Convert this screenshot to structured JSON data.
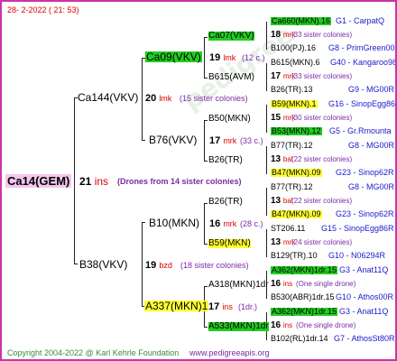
{
  "header": {
    "date": "28-  2-2022 ( 21: 53)"
  },
  "footer": {
    "copyright": "Copyright 2004-2022 @ Karl Kehrle Foundation",
    "url": "www.pedigreeapis.org"
  },
  "watermark": "pedigree",
  "root": {
    "id": "Ca14(GEM)",
    "count": "21",
    "unit": "ins",
    "note": "(Drones from 14 sister colonies)"
  },
  "gen1": {
    "top": {
      "id": "Ca144(VKV)",
      "count": "20",
      "unit": "lmk",
      "note": "(15 sister colonies)"
    },
    "bottom": {
      "id": "B38(VKV)",
      "count": "19",
      "unit": "bzd",
      "note": "(18 sister colonies)"
    }
  },
  "gen2": {
    "a": {
      "id": "Ca09(VKV)",
      "count": "19",
      "unit": "lmk",
      "note": "(12 c.)"
    },
    "b": {
      "id": "B76(VKV)",
      "count": "17",
      "unit": "mrk",
      "note": "(33 c.)"
    },
    "c": {
      "id": "B10(MKN)",
      "count": "16",
      "unit": "mrk",
      "note": "(28 c.)"
    },
    "d": {
      "id": "A337(MKN)1",
      "count": "17",
      "unit": "ins",
      "note": "(1dr.)"
    }
  },
  "gen3": {
    "a1": {
      "id": "Ca07(VKV)"
    },
    "a2": {
      "id": "B615(AVM)"
    },
    "b1": {
      "id": "B50(MKN)"
    },
    "b2": {
      "id": "B26(TR)"
    },
    "c1": {
      "id": "B26(TR)"
    },
    "c2": {
      "id": "B59(MKN)"
    },
    "d1": {
      "id": "A318(MKN)1dr"
    },
    "d2": {
      "id": "A533(MKN)1dr"
    }
  },
  "gen4": [
    {
      "id": "Ca660(MKN).16",
      "code": "G1 - CarpatQ"
    },
    {
      "count": "18",
      "unit": "mrk",
      "note": "(33 sister colonies)"
    },
    {
      "id": "B100(PJ).16",
      "code": "G8 - PrimGreen00"
    },
    {
      "id": "B615(MKN).6",
      "code": "G40 - Kangaroo98R"
    },
    {
      "count": "17",
      "unit": "mrk",
      "note": "(33 sister colonies)"
    },
    {
      "id": "B26(TR).13",
      "code": "G9 - MG00R"
    },
    {
      "id": "B59(MKN).1",
      "code": "G16 - SinopEgg86R"
    },
    {
      "count": "15",
      "unit": "mrk",
      "note": "(30 sister colonies)"
    },
    {
      "id": "B53(MKN).12",
      "code": "G5 - Gr.Rmounta"
    },
    {
      "id": "B77(TR).12",
      "code": "G8 - MG00R"
    },
    {
      "count": "13",
      "unit": "bal",
      "note": "(22 sister colonies)"
    },
    {
      "id": "B47(MKN).09",
      "code": "G23 - Sinop62R"
    },
    {
      "id": "B77(TR).12",
      "code": "G8 - MG00R"
    },
    {
      "count": "13",
      "unit": "bal",
      "note": "(22 sister colonies)"
    },
    {
      "id": "B47(MKN).09",
      "code": "G23 - Sinop62R"
    },
    {
      "id": "ST206.11",
      "code": "G15 - SinopEgg86R"
    },
    {
      "count": "13",
      "unit": "mrk",
      "note": "(24 sister colonies)"
    },
    {
      "id": "B129(TR).10",
      "code": "G10 - N06294R"
    },
    {
      "id": "A362(MKN)1dr.15",
      "code": "G3 - Anat11Q"
    },
    {
      "count": "16",
      "unit": "ins",
      "note": "(One single drone)"
    },
    {
      "id": "B530(ABR)1dr.15",
      "code": "G10 - Athos00R"
    },
    {
      "id": "A362(MKN)1dr.15",
      "code": "G3 - Anat11Q"
    },
    {
      "count": "16",
      "unit": "ins",
      "note": "(One single drone)"
    },
    {
      "id": "B102(RL)1dr.14",
      "code": "G7 - AthosSt80R"
    }
  ]
}
